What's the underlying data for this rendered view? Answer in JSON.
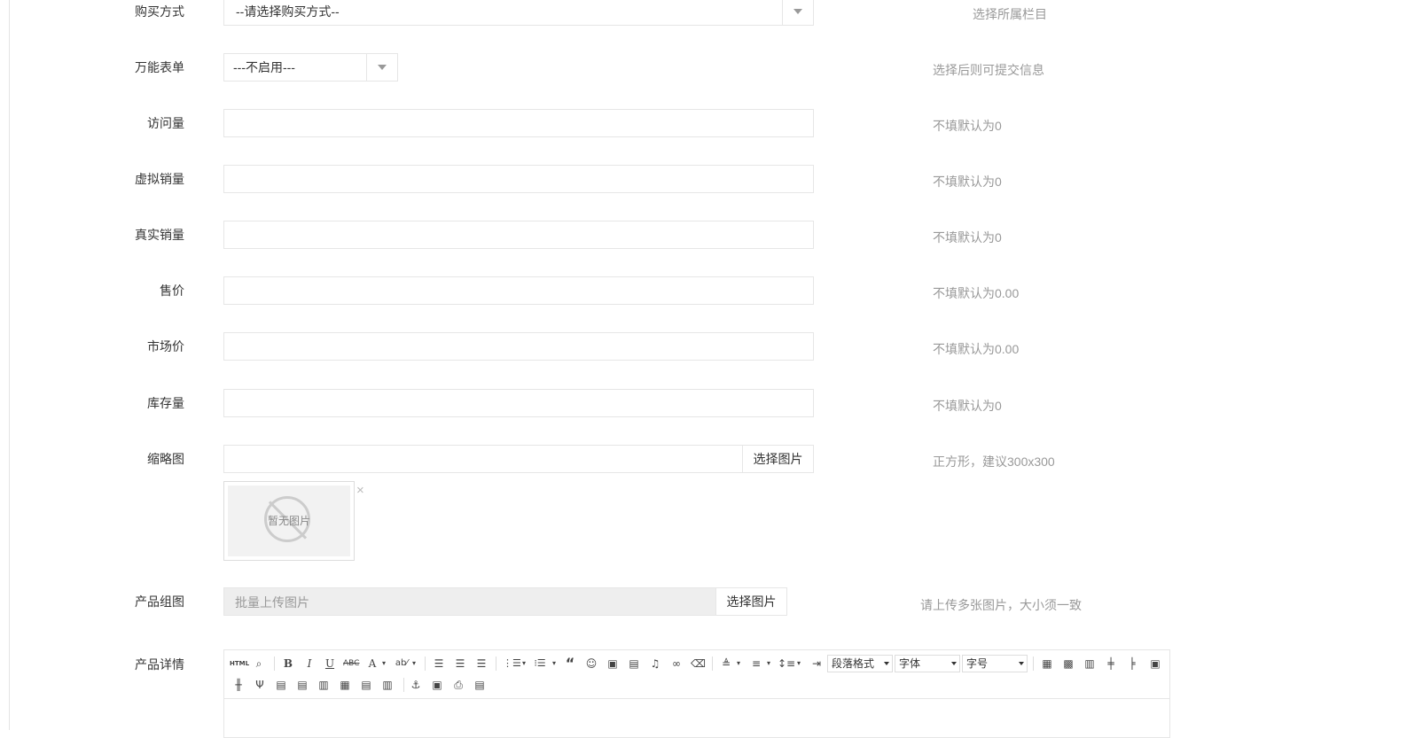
{
  "form": {
    "purchase": {
      "label": "购买方式",
      "value": "--请选择购买方式--",
      "hint": "选择所属栏目"
    },
    "form_builder": {
      "label": "万能表单",
      "value": "---不启用---",
      "hint": "选择后则可提交信息"
    },
    "visits": {
      "label": "访问量",
      "value": "",
      "hint": "不填默认为0"
    },
    "virtual_sales": {
      "label": "虚拟销量",
      "value": "",
      "hint": "不填默认为0"
    },
    "real_sales": {
      "label": "真实销量",
      "value": "",
      "hint": "不填默认为0"
    },
    "price": {
      "label": "售价",
      "value": "",
      "hint": "不填默认为0.00"
    },
    "market_price": {
      "label": "市场价",
      "value": "",
      "hint": "不填默认为0.00"
    },
    "stock": {
      "label": "库存量",
      "value": "",
      "hint": "不填默认为0"
    },
    "thumbnail": {
      "label": "缩略图",
      "value": "",
      "button": "选择图片",
      "hint": "正方形，建议300x300",
      "no_image_text": "暂无图片",
      "close": "×"
    },
    "gallery": {
      "label": "产品组图",
      "placeholder": "批量上传图片",
      "button": "选择图片",
      "hint": "请上传多张图片，大小须一致"
    },
    "details": {
      "label": "产品详情",
      "toolbar": {
        "html_label": "HTML",
        "paragraph_format": "段落格式",
        "font_family": "字体",
        "font_size": "字号"
      }
    }
  },
  "icons": {
    "source": "html-source-icon",
    "preview": "preview-icon",
    "bold": "bold-icon",
    "italic": "italic-icon",
    "underline": "underline-icon",
    "strikethrough": "strikethrough-icon",
    "font_color": "font-color-icon",
    "highlight": "highlight-icon",
    "align_left": "align-left-icon",
    "align_center": "align-center-icon",
    "align_right": "align-right-icon",
    "ordered_list": "ordered-list-icon",
    "unordered_list": "unordered-list-icon",
    "blockquote": "blockquote-icon",
    "emoji": "emoji-icon",
    "image": "image-icon",
    "video": "video-icon",
    "music": "music-icon",
    "link": "link-icon",
    "eraser": "eraser-icon"
  }
}
